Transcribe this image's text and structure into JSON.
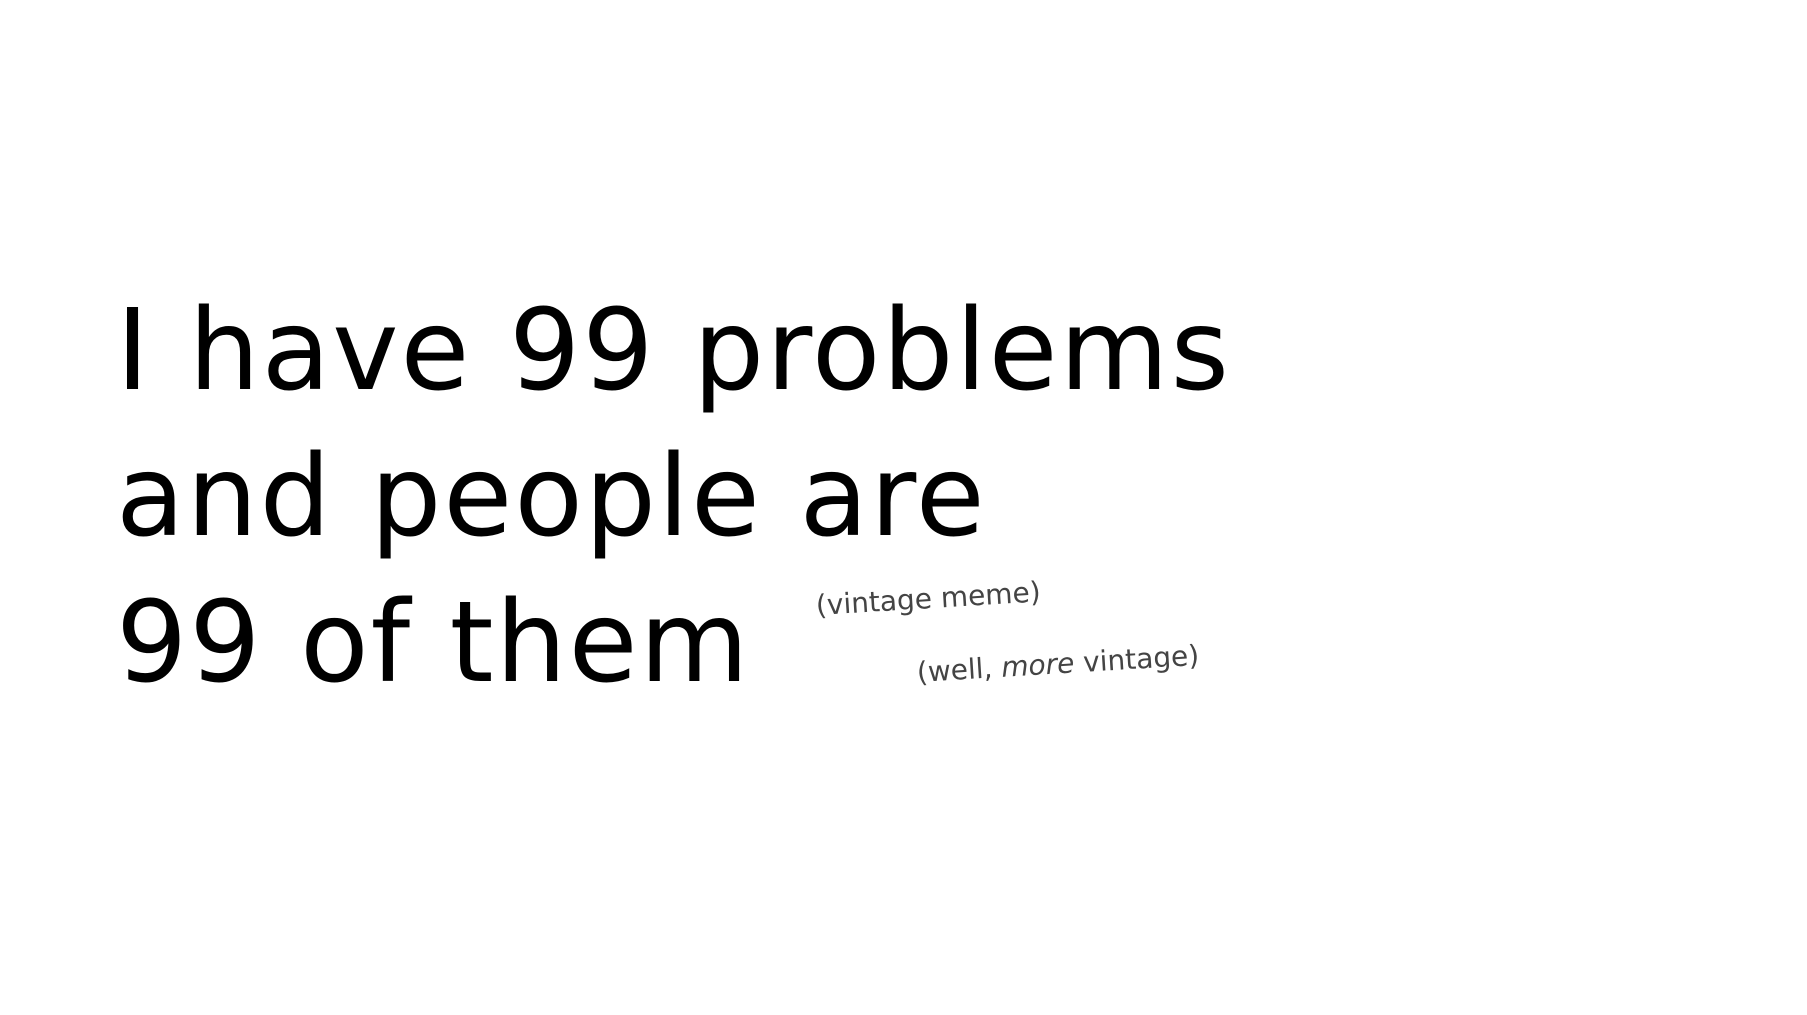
{
  "slide": {
    "headline_lines": [
      "I have 99 problems",
      "and people are",
      "99 of them"
    ],
    "aside_1": "(vintage meme)",
    "aside_2": {
      "prefix": "(well, ",
      "emphasis": "more",
      "suffix": " vintage)"
    }
  },
  "colors": {
    "background": "#ffffff",
    "headline": "#000000",
    "aside": "#444444"
  }
}
